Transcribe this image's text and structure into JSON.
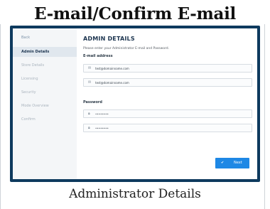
{
  "heading": "E-mail/Confirm E-mail",
  "caption": "Administrator Details",
  "sidebar": {
    "items": [
      {
        "label": "Back"
      },
      {
        "label": "Admin Details"
      },
      {
        "label": "Store Details"
      },
      {
        "label": "Licensing"
      },
      {
        "label": "Security"
      },
      {
        "label": "Mode Overview"
      },
      {
        "label": "Confirm"
      }
    ]
  },
  "main": {
    "title": "ADMIN DETAILS",
    "instruction": "Please enter your Administrator E-mail and Password.",
    "email_section": "E-mail address",
    "email": "test@domainname.com",
    "confirm_email": "test@domainname.com",
    "password_section": "Password",
    "password": "••••••••",
    "confirm_password": "••••••••",
    "next_label": "Next"
  },
  "colors": {
    "frame_bg": "#0e3a5e",
    "accent": "#1e88e5",
    "sidebar_bg": "#f4f6f8"
  }
}
